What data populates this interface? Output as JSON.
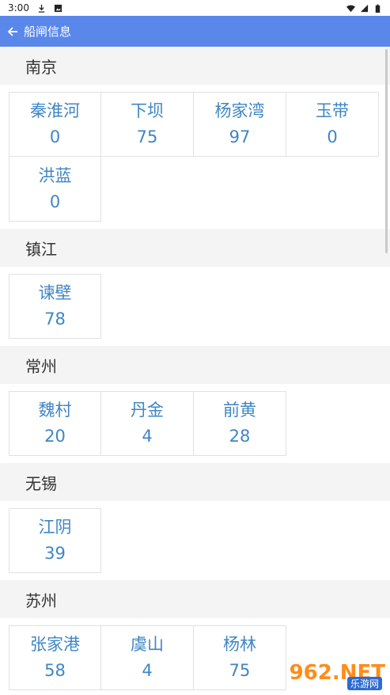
{
  "status": {
    "time": "3:00"
  },
  "header": {
    "title": "船闸信息"
  },
  "regions": [
    {
      "name": "南京",
      "locks": [
        {
          "name": "秦淮河",
          "value": "0"
        },
        {
          "name": "下坝",
          "value": "75"
        },
        {
          "name": "杨家湾",
          "value": "97"
        },
        {
          "name": "玉带",
          "value": "0"
        },
        {
          "name": "洪蓝",
          "value": "0"
        }
      ]
    },
    {
      "name": "镇江",
      "locks": [
        {
          "name": "谏壁",
          "value": "78"
        }
      ]
    },
    {
      "name": "常州",
      "locks": [
        {
          "name": "魏村",
          "value": "20"
        },
        {
          "name": "丹金",
          "value": "4"
        },
        {
          "name": "前黄",
          "value": "28"
        }
      ]
    },
    {
      "name": "无锡",
      "locks": [
        {
          "name": "江阴",
          "value": "39"
        }
      ]
    },
    {
      "name": "苏州",
      "locks": [
        {
          "name": "张家港",
          "value": "58"
        },
        {
          "name": "虞山",
          "value": "4"
        },
        {
          "name": "杨林",
          "value": "75"
        }
      ]
    }
  ],
  "watermark": {
    "text": "962.NET",
    "sub": "乐游网"
  },
  "colors": {
    "accent": "#5a87ea",
    "value_text": "#3f86c4",
    "section_bg": "#f4f4f4"
  }
}
